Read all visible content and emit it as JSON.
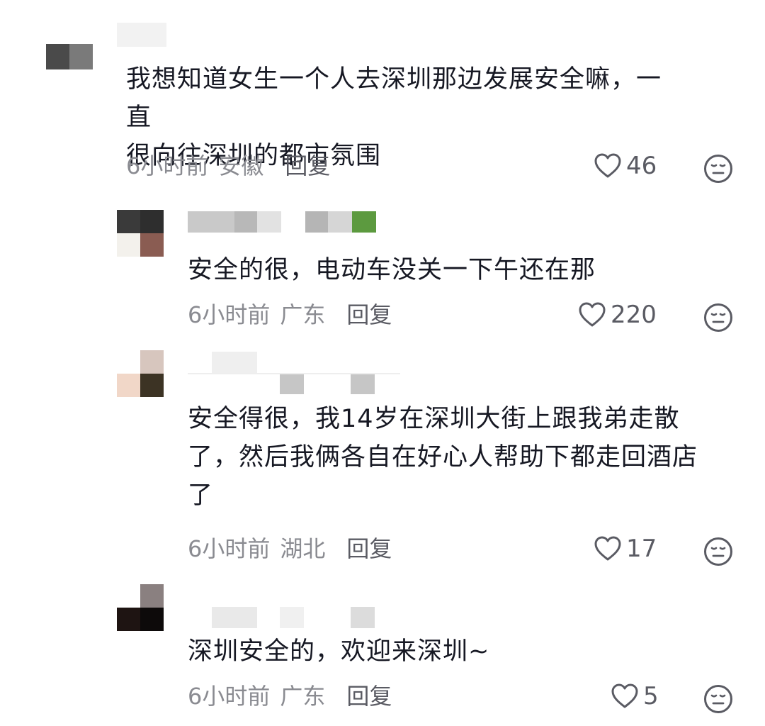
{
  "comments": [
    {
      "text": "我想知道女生一个人去深圳那边发展安全嘛，一直\n很向往深圳的都市氛围",
      "time": "6小时前",
      "location": "安徽",
      "reply_label": "回复",
      "likes": "46",
      "like_icon": "heart-outline-icon",
      "dislike_icon": "meh-face-icon"
    },
    {
      "text": "安全的很，电动车没关一下午还在那",
      "time": "6小时前",
      "location": "广东",
      "reply_label": "回复",
      "likes": "220",
      "like_icon": "heart-outline-icon",
      "dislike_icon": "meh-face-icon"
    },
    {
      "text": "安全得很，我14岁在深圳大街上跟我弟走散\n了，然后我俩各自在好心人帮助下都走回酒店\n了",
      "time": "6小时前",
      "location": "湖北",
      "reply_label": "回复",
      "likes": "17",
      "like_icon": "heart-outline-icon",
      "dislike_icon": "meh-face-icon"
    },
    {
      "text": "深圳安全的，欢迎来深圳~",
      "time": "6小时前",
      "location": "广东",
      "reply_label": "回复",
      "likes": "5",
      "like_icon": "heart-outline-icon",
      "dislike_icon": "meh-face-icon"
    }
  ],
  "colors": {
    "text": "#161823",
    "meta": "#8a8b91",
    "reply": "#5a5b63",
    "icon": "#5a5b63",
    "background": "#ffffff"
  }
}
